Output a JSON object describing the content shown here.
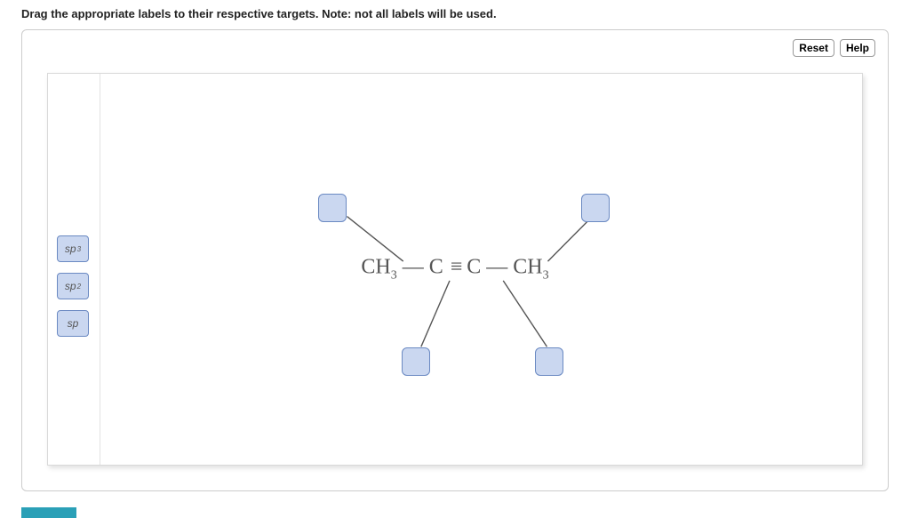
{
  "instruction": "Drag the appropriate labels to their respective targets. Note: not all labels will be used.",
  "buttons": {
    "reset": "Reset",
    "help": "Help"
  },
  "labels": {
    "sp3_base": "sp",
    "sp3_sup": "3",
    "sp2_base": "sp",
    "sp2_sup": "2",
    "sp_base": "sp"
  },
  "formula": {
    "ch3_a": "CH",
    "sub3_a": "3",
    "dash_a": "—",
    "c_a": "C",
    "triple": "≡",
    "c_b": "C",
    "dash_b": "—",
    "ch3_b": "CH",
    "sub3_b": "3"
  }
}
